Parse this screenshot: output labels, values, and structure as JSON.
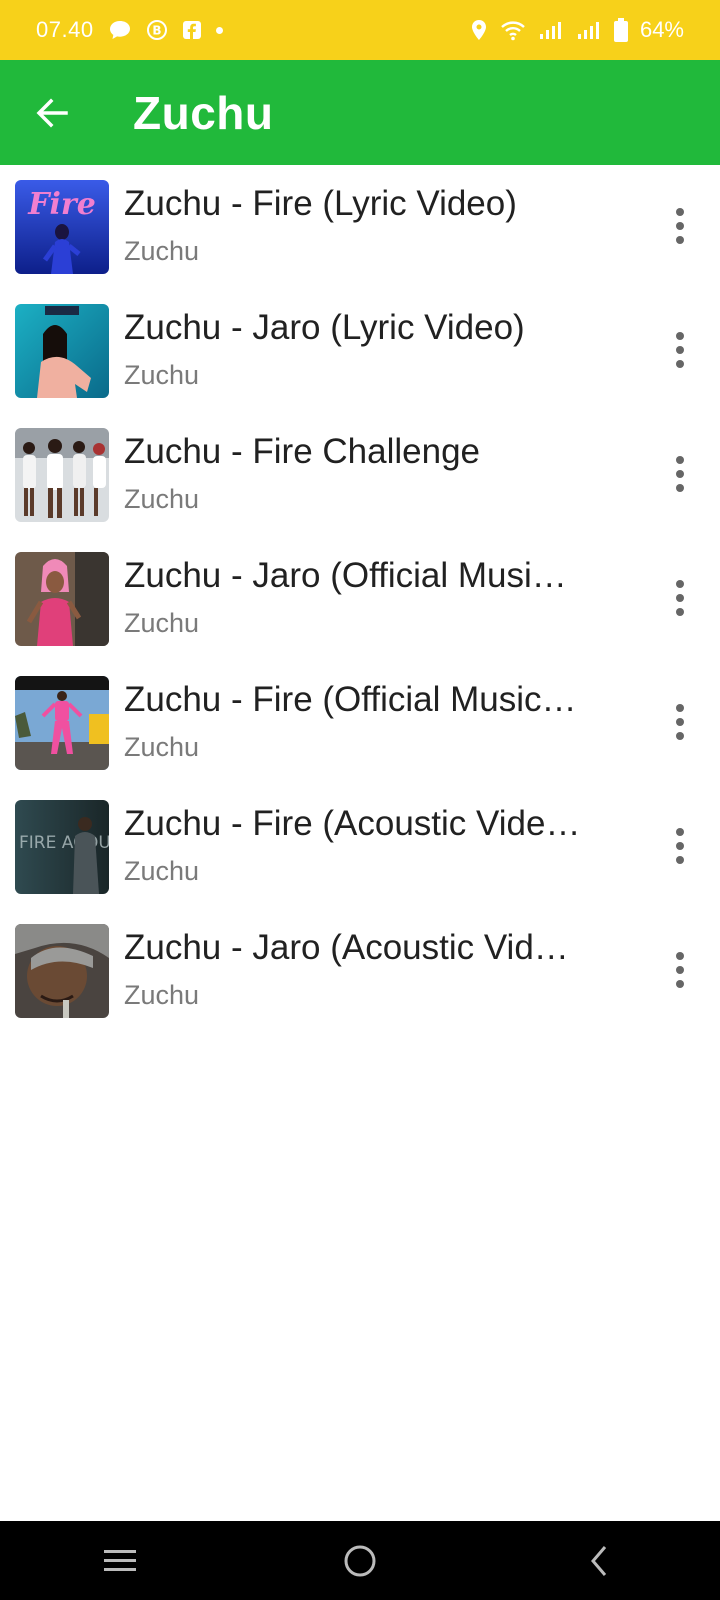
{
  "status_bar": {
    "time": "07.40",
    "battery": "64%",
    "left_icons": [
      "chat-bubble-icon",
      "b-badge-icon",
      "facebook-icon",
      "dot-icon"
    ],
    "right_icons": [
      "location-icon",
      "wifi-icon",
      "signal-icon",
      "signal-icon",
      "battery-icon"
    ]
  },
  "app_bar": {
    "title": "Zuchu",
    "back_icon": "arrow-left-icon"
  },
  "videos": [
    {
      "title": "Zuchu - Fire (Lyric Video)",
      "channel": "Zuchu"
    },
    {
      "title": "Zuchu - Jaro (Lyric Video)",
      "channel": "Zuchu"
    },
    {
      "title": "Zuchu - Fire Challenge",
      "channel": "Zuchu"
    },
    {
      "title": "Zuchu - Jaro (Official Musi…",
      "channel": "Zuchu"
    },
    {
      "title": "Zuchu - Fire (Official Music…",
      "channel": "Zuchu"
    },
    {
      "title": "Zuchu - Fire (Acoustic Vide…",
      "channel": "Zuchu"
    },
    {
      "title": "Zuchu - Jaro (Acoustic Vid…",
      "channel": "Zuchu"
    }
  ],
  "thumbnail_text": {
    "fire_logo": "Fire",
    "acoustic_overlay": "FIRE ACOUSTIC"
  },
  "nav_bar": {
    "icons": [
      "menu-icon",
      "home-circle-icon",
      "back-chevron-icon"
    ]
  },
  "colors": {
    "status_bar": "#F7D11A",
    "app_bar": "#21B93B",
    "title_text": "#212121",
    "subtitle_text": "#7a7a7a"
  }
}
